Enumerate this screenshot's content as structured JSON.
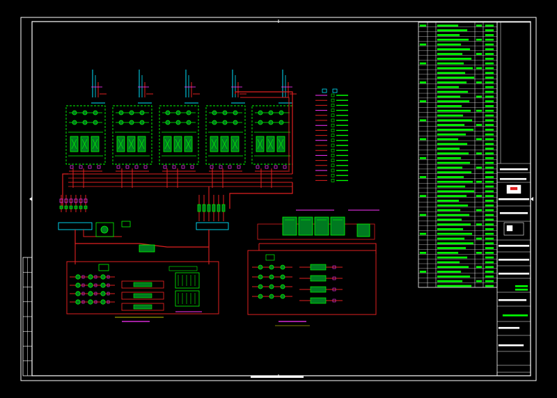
{
  "drawing": {
    "background": "#000000",
    "colors": {
      "frame": "#ffffff",
      "pipe_red": "#e02020",
      "pipe_dark": "#b01818",
      "equipment": "#00ff00",
      "equipment_fill": "#007a20",
      "cyan": "#00e5ff",
      "magenta": "#ff33ff",
      "yellow": "#ffff00",
      "blue": "#2a6bff",
      "table_text": "#00ff00"
    },
    "legend_rows": 18,
    "spec_rows": 56,
    "left_strip_cells": 8,
    "title_block_rows": 12
  }
}
